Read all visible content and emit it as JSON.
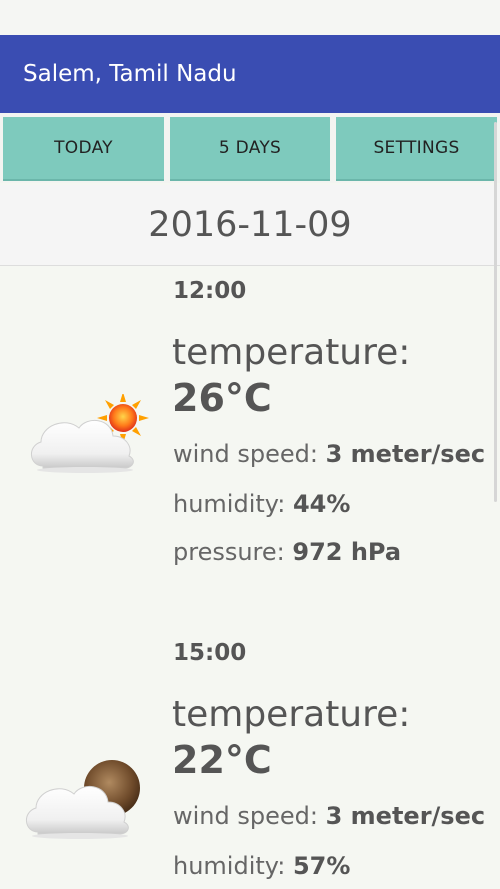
{
  "app": {
    "title": "Salem, Tamil Nadu"
  },
  "tabs": [
    {
      "label": "TODAY"
    },
    {
      "label": "5 DAYS"
    },
    {
      "label": "SETTINGS"
    }
  ],
  "date": "2016-11-09",
  "forecasts": [
    {
      "time": "12:00",
      "temperature_label": "temperature:",
      "temperature": "26°C",
      "wind_label": "wind speed:",
      "wind": "3 meter/sec",
      "humidity_label": "humidity:",
      "humidity": "44%",
      "pressure_label": "pressure:",
      "pressure": "972 hPa",
      "icon": "cloud-sun-icon"
    },
    {
      "time": "15:00",
      "temperature_label": "temperature:",
      "temperature": "22°C",
      "wind_label": "wind speed:",
      "wind": "3 meter/sec",
      "humidity_label": "humidity:",
      "humidity": "57%",
      "icon": "cloud-moon-icon"
    }
  ],
  "colors": {
    "appbar": "#3a4db2",
    "tab": "#7ecabd"
  }
}
